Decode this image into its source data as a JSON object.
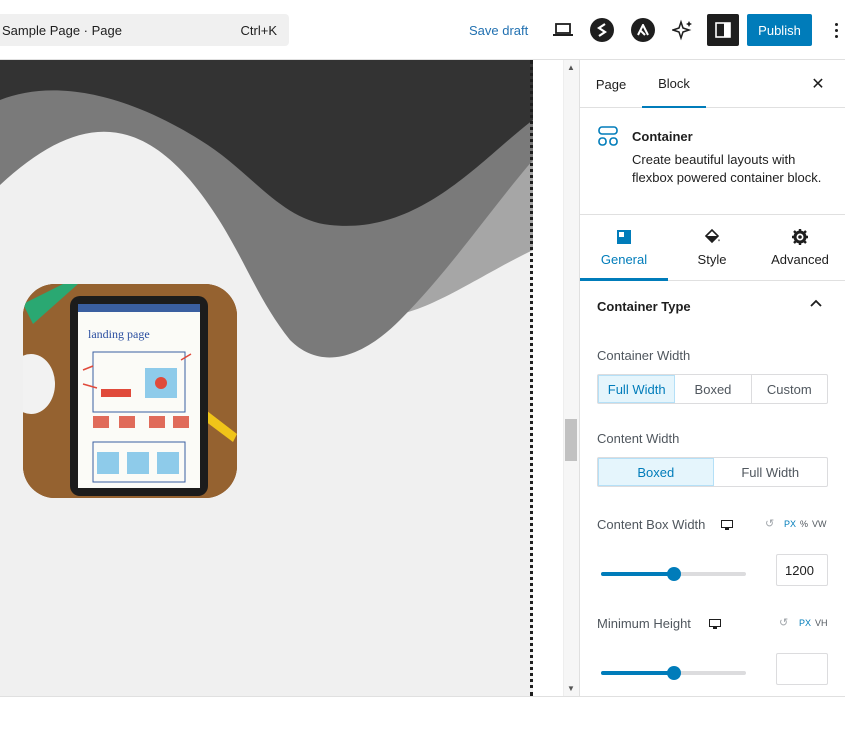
{
  "header": {
    "command_title": "Sample Page · Page",
    "command_shortcut": "Ctrl+K",
    "save_draft_label": "Save draft",
    "publish_label": "Publish",
    "accent_color": "#007cba"
  },
  "sidebar": {
    "tabs": [
      {
        "label": "Page",
        "active": false
      },
      {
        "label": "Block",
        "active": true
      }
    ],
    "block": {
      "name": "Container",
      "description": "Create beautiful layouts with flexbox powered container block."
    },
    "panel_tabs": [
      {
        "label": "General",
        "icon": "general-icon",
        "active": true
      },
      {
        "label": "Style",
        "icon": "paint-bucket-icon",
        "active": false
      },
      {
        "label": "Advanced",
        "icon": "gear-icon",
        "active": false
      }
    ],
    "section_title": "Container Type",
    "container_width": {
      "label": "Container Width",
      "options": [
        "Full Width",
        "Boxed",
        "Custom"
      ],
      "selected": "Full Width"
    },
    "content_width": {
      "label": "Content Width",
      "options": [
        "Boxed",
        "Full Width"
      ],
      "selected": "Boxed"
    },
    "content_box_width": {
      "label": "Content Box Width",
      "units": [
        "PX",
        "%",
        "VW"
      ],
      "selected_unit": "PX",
      "value": "1200",
      "slider_fraction": 0.5
    },
    "minimum_height": {
      "label": "Minimum Height",
      "units": [
        "PX",
        "VH"
      ],
      "selected_unit": "PX",
      "value": "",
      "slider_fraction": 0.5
    }
  },
  "canvas": {
    "image_subject": "tablet showing landing page wireframe sketch",
    "image_text": "landing page"
  }
}
